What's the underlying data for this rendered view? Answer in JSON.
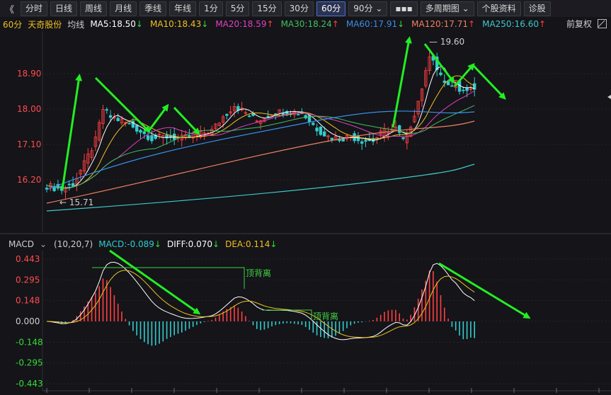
{
  "toolbar": {
    "back": "《",
    "buttons": [
      "分时",
      "日线",
      "周线",
      "月线",
      "季线",
      "年线",
      "1分",
      "5分",
      "15分",
      "30分",
      "60分",
      "90分 ⌄",
      "▪▪▪",
      "多周期图 ⌄",
      "个股资料",
      "诊股"
    ],
    "active": "60分"
  },
  "info": {
    "period": "60分",
    "stock_name": "天奇股份",
    "avg_label": "均线",
    "ma": [
      {
        "label": "MA5:18.50",
        "arrow": "↓",
        "color": "#ffffff",
        "arrow_color": "#33dd33"
      },
      {
        "label": "MA10:18.43",
        "arrow": "↓",
        "color": "#f0c020",
        "arrow_color": "#33dd33"
      },
      {
        "label": "MA20:18.59",
        "arrow": "↑",
        "color": "#e040c0",
        "arrow_color": "#ff4040"
      },
      {
        "label": "MA30:18.24",
        "arrow": "↑",
        "color": "#40c060",
        "arrow_color": "#ff4040"
      },
      {
        "label": "MA60:17.91",
        "arrow": "↓",
        "color": "#3a8ee6",
        "arrow_color": "#33dd33"
      },
      {
        "label": "MA120:17.71",
        "arrow": "↑",
        "color": "#f08060",
        "arrow_color": "#ff4040"
      },
      {
        "label": "MA250:16.60",
        "arrow": "↑",
        "color": "#40c8c8",
        "arrow_color": "#ff4040"
      }
    ],
    "fq": "前复权"
  },
  "price_axis": [
    "18.90",
    "18.00",
    "17.10",
    "16.20"
  ],
  "macd_axis": [
    "0.443",
    "0.295",
    "0.148",
    "0.000",
    "-0.148",
    "-0.295",
    "-0.443"
  ],
  "macd": {
    "name": "MACD",
    "params": "(10,20,7)",
    "macd_label": "MACD:-0.089",
    "macd_arrow": "↓",
    "diff_label": "DIFF:0.070",
    "diff_arrow": "↓",
    "dea_label": "DEA:0.114",
    "dea_arrow": "↓"
  },
  "annotations": {
    "high": "19.60",
    "low": "15.71",
    "divergence1": "顶背离",
    "divergence2": "顶背离"
  },
  "colors": {
    "up": "#ff4040",
    "down": "#33cccc",
    "arrow": "#22ee22"
  }
}
